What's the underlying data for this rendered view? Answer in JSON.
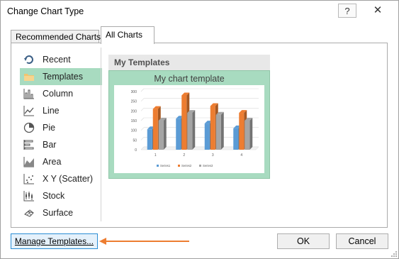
{
  "window": {
    "title": "Change Chart Type",
    "help_glyph": "?",
    "close_glyph": "✕"
  },
  "tabs": [
    {
      "label": "Recommended Charts",
      "active": false
    },
    {
      "label": "All Charts",
      "active": true
    }
  ],
  "chart_types": [
    {
      "label": "Recent",
      "icon": "recent-icon",
      "selected": false
    },
    {
      "label": "Templates",
      "icon": "folder-icon",
      "selected": true
    },
    {
      "label": "Column",
      "icon": "column-chart-icon",
      "selected": false
    },
    {
      "label": "Line",
      "icon": "line-chart-icon",
      "selected": false
    },
    {
      "label": "Pie",
      "icon": "pie-chart-icon",
      "selected": false
    },
    {
      "label": "Bar",
      "icon": "bar-chart-icon",
      "selected": false
    },
    {
      "label": "Area",
      "icon": "area-chart-icon",
      "selected": false
    },
    {
      "label": "X Y (Scatter)",
      "icon": "scatter-chart-icon",
      "selected": false
    },
    {
      "label": "Stock",
      "icon": "stock-chart-icon",
      "selected": false
    },
    {
      "label": "Surface",
      "icon": "surface-chart-icon",
      "selected": false
    }
  ],
  "templates": {
    "header": "My Templates",
    "items": [
      {
        "name": "My chart template"
      }
    ]
  },
  "chart_data": {
    "type": "bar",
    "categories": [
      "1",
      "2",
      "3",
      "4"
    ],
    "series": [
      {
        "name": "Series1",
        "values": [
          105,
          160,
          135,
          110
        ],
        "color": "#5b9bd5"
      },
      {
        "name": "Series2",
        "values": [
          210,
          280,
          225,
          190
        ],
        "color": "#ed7d31"
      },
      {
        "name": "Series3",
        "values": [
          150,
          190,
          180,
          150
        ],
        "color": "#a5a5a5"
      }
    ],
    "yticks": [
      "0",
      "50",
      "100",
      "150",
      "200",
      "250",
      "300"
    ],
    "ylim": [
      0,
      300
    ],
    "grid": true,
    "legend": "bottom"
  },
  "footer": {
    "manage_label": "Manage Templates...",
    "ok_label": "OK",
    "cancel_label": "Cancel"
  },
  "colors": {
    "selection": "#a8dbc0",
    "arrow": "#ed7d31"
  }
}
